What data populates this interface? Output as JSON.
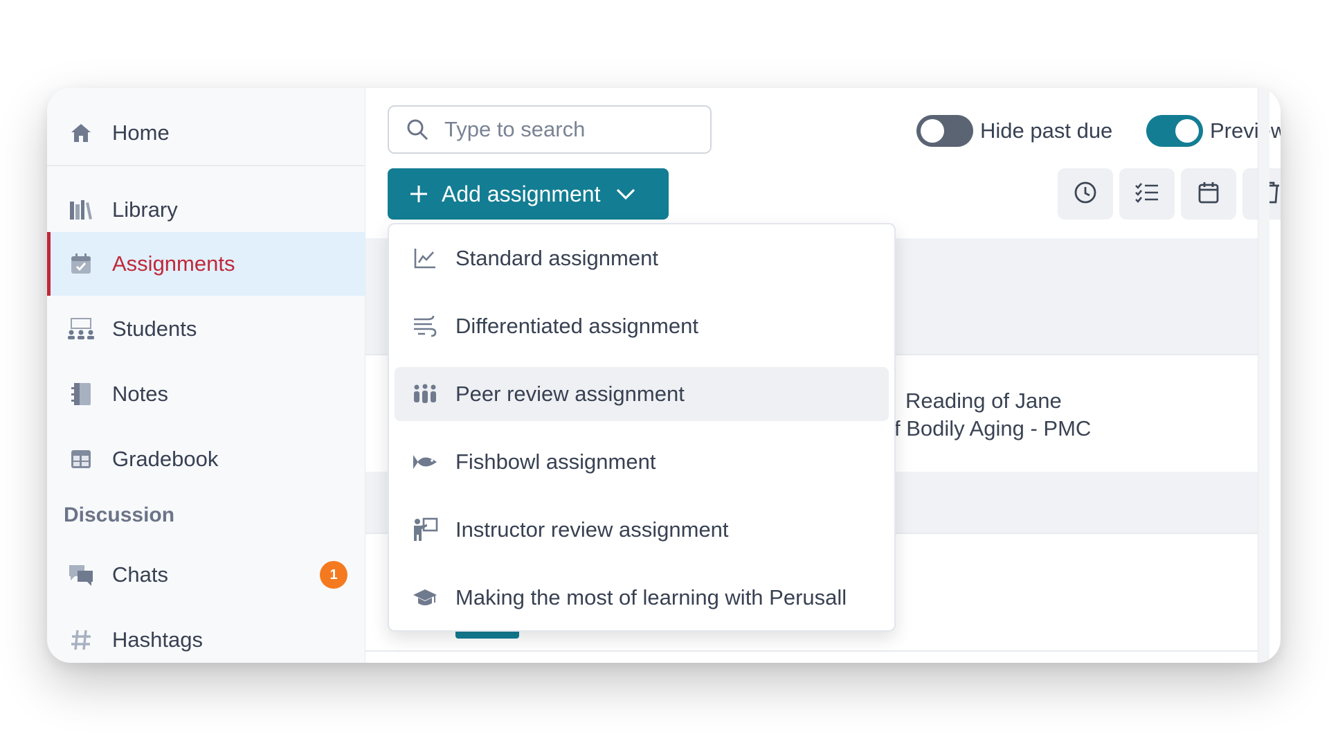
{
  "sidebar": {
    "items": [
      {
        "label": "Home",
        "icon": "home-icon"
      },
      {
        "label": "Library",
        "icon": "library-icon"
      },
      {
        "label": "Assignments",
        "icon": "calendar-check-icon",
        "active": true
      },
      {
        "label": "Students",
        "icon": "students-icon"
      },
      {
        "label": "Notes",
        "icon": "notebook-icon"
      },
      {
        "label": "Gradebook",
        "icon": "gradebook-icon"
      }
    ],
    "section_label": "Discussion",
    "discussion_items": [
      {
        "label": "Chats",
        "icon": "chat-bubbles-icon",
        "badge": "1"
      },
      {
        "label": "Hashtags",
        "icon": "hashtag-icon"
      }
    ]
  },
  "toolbar": {
    "search_placeholder": "Type to search",
    "hide_past_due_label": "Hide past due",
    "hide_past_due_on": false,
    "preview_label": "Preview",
    "preview_on": true,
    "add_assignment_label": "Add assignment",
    "tools": [
      "clock-icon",
      "checklist-icon",
      "calendar-icon",
      "trash-icon"
    ]
  },
  "dropdown": {
    "items": [
      {
        "label": "Standard assignment",
        "icon": "line-chart-icon"
      },
      {
        "label": "Differentiated assignment",
        "icon": "differentiated-icon"
      },
      {
        "label": "Peer review assignment",
        "icon": "peer-group-icon",
        "highlighted": true
      },
      {
        "label": "Fishbowl assignment",
        "icon": "fish-icon"
      },
      {
        "label": "Instructor review assignment",
        "icon": "instructor-icon"
      },
      {
        "label": "Making the most of learning with Perusall",
        "icon": "graduation-cap-icon"
      }
    ]
  },
  "assignment_rows": [
    {
      "text_line1": "Reading of Jane",
      "text_line2": "f Bodily Aging - PMC"
    }
  ],
  "colors": {
    "accent": "#137d93",
    "active_text": "#c0283a",
    "active_bg": "#e1f0fb",
    "badge": "#f57a1f"
  }
}
